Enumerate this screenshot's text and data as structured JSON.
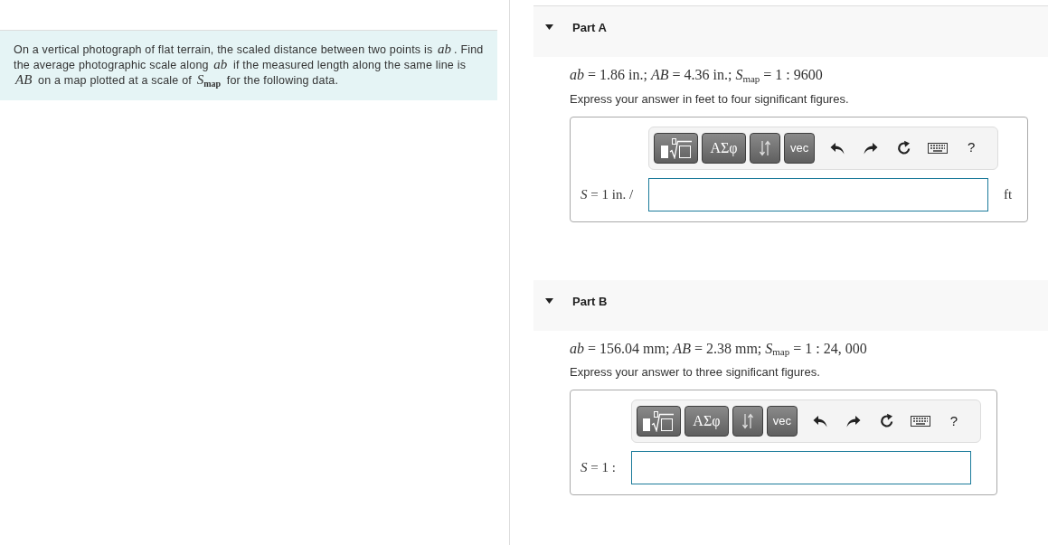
{
  "problem": {
    "text": "On a vertical photograph of flat terrain, the scaled distance between two points is *ab*. Find the average photographic scale along *ab* if the measured length along the same line is *AB* on a map plotted at a scale of *S*$_{map}$ for the following data."
  },
  "parts": [
    {
      "title": "Part A",
      "expanded": true,
      "given": "*ab* = 1.86 in.; *AB* = 4.36 in.; *S*$_{map}$ = 1 : 9600",
      "instruction": "Express your answer in feet to four significant figures.",
      "toolbar": [
        {
          "kind": "templates"
        },
        {
          "kind": "symbols",
          "label": "ΑΣφ"
        },
        {
          "kind": "arrows"
        },
        {
          "kind": "vec",
          "label": "vec"
        },
        {
          "kind": "undo"
        },
        {
          "kind": "redo"
        },
        {
          "kind": "reset"
        },
        {
          "kind": "keyboard"
        },
        {
          "kind": "help",
          "label": "?"
        }
      ],
      "answer": {
        "label": "*S* = 1 in. /",
        "unit": "ft"
      }
    },
    {
      "title": "Part B",
      "expanded": true,
      "given": "*ab* = 156.04 mm; *AB* = 2.38 mm; *S*$_{map}$ = 1 : 24, 000",
      "instruction": "Express your answer to three significant figures.",
      "toolbar": [
        {
          "kind": "templates"
        },
        {
          "kind": "symbols",
          "label": "ΑΣφ"
        },
        {
          "kind": "arrows"
        },
        {
          "kind": "vec",
          "label": "vec"
        },
        {
          "kind": "undo"
        },
        {
          "kind": "redo"
        },
        {
          "kind": "reset"
        },
        {
          "kind": "keyboard"
        },
        {
          "kind": "help",
          "label": "?"
        }
      ],
      "answer": {
        "label": "*S* = 1 :"
      }
    }
  ]
}
